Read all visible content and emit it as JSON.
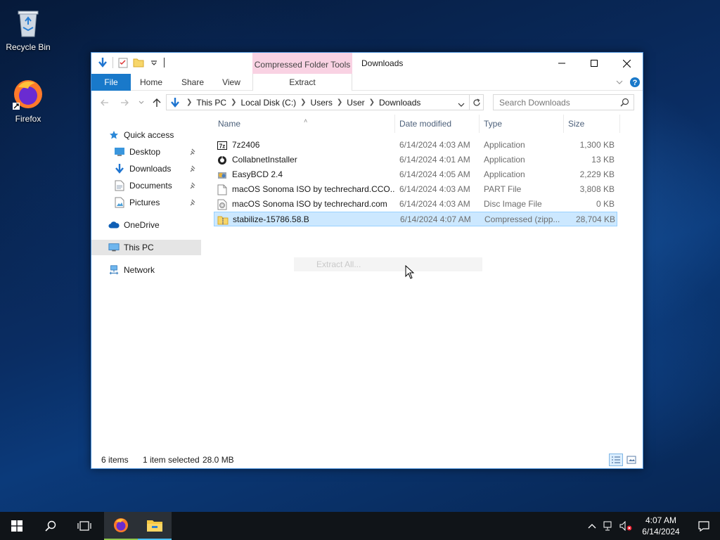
{
  "desktop": {
    "icons": [
      {
        "label": "Recycle Bin",
        "icon": "recycle-bin-icon"
      },
      {
        "label": "Firefox",
        "icon": "firefox-icon"
      }
    ]
  },
  "window": {
    "contextual_tab_group": "Compressed Folder Tools",
    "title": "Downloads",
    "ribbon_tabs": {
      "file": "File",
      "home": "Home",
      "share": "Share",
      "view": "View",
      "extract": "Extract"
    },
    "address": {
      "crumbs": [
        "This PC",
        "Local Disk (C:)",
        "Users",
        "User",
        "Downloads"
      ]
    },
    "search": {
      "placeholder": "Search Downloads"
    }
  },
  "navpane": {
    "items": [
      {
        "label": "Quick access",
        "icon": "star-icon"
      },
      {
        "label": "Desktop",
        "icon": "desktop-folder-icon",
        "pinned": true
      },
      {
        "label": "Downloads",
        "icon": "downloads-folder-icon",
        "pinned": true
      },
      {
        "label": "Documents",
        "icon": "documents-folder-icon",
        "pinned": true
      },
      {
        "label": "Pictures",
        "icon": "pictures-folder-icon",
        "pinned": true
      },
      {
        "label": "OneDrive",
        "icon": "onedrive-cloud-icon"
      },
      {
        "label": "This PC",
        "icon": "computer-icon",
        "selected": true
      },
      {
        "label": "Network",
        "icon": "network-icon"
      }
    ]
  },
  "filelist": {
    "columns": {
      "name": "Name",
      "date": "Date modified",
      "type": "Type",
      "size": "Size"
    },
    "rows": [
      {
        "name": "7z2406",
        "date": "6/14/2024 4:03 AM",
        "type": "Application",
        "size": "1,300 KB",
        "icon": "7zip-installer-icon"
      },
      {
        "name": "CollabnetInstaller",
        "date": "6/14/2024 4:01 AM",
        "type": "Application",
        "size": "13 KB",
        "icon": "installer-app-icon"
      },
      {
        "name": "EasyBCD 2.4",
        "date": "6/14/2024 4:05 AM",
        "type": "Application",
        "size": "2,229 KB",
        "icon": "easybcd-app-icon"
      },
      {
        "name": "macOS Sonoma ISO by techrechard.CCO...",
        "date": "6/14/2024 4:03 AM",
        "type": "PART File",
        "size": "3,808 KB",
        "icon": "blank-file-icon"
      },
      {
        "name": "macOS Sonoma ISO by techrechard.com",
        "date": "6/14/2024 4:03 AM",
        "type": "Disc Image File",
        "size": "0 KB",
        "icon": "disc-image-icon"
      },
      {
        "name": "stabilize-15786.58.B",
        "date": "6/14/2024 4:07 AM",
        "type": "Compressed (zipp...",
        "size": "28,704 KB",
        "icon": "zip-folder-icon",
        "selected": true
      }
    ]
  },
  "context_ghost": {
    "label": "Extract All..."
  },
  "status": {
    "items": "6 items",
    "selected": "1 item selected",
    "size": "28.0 MB"
  },
  "taskbar": {
    "clock_time": "4:07 AM",
    "clock_date": "6/14/2024"
  }
}
